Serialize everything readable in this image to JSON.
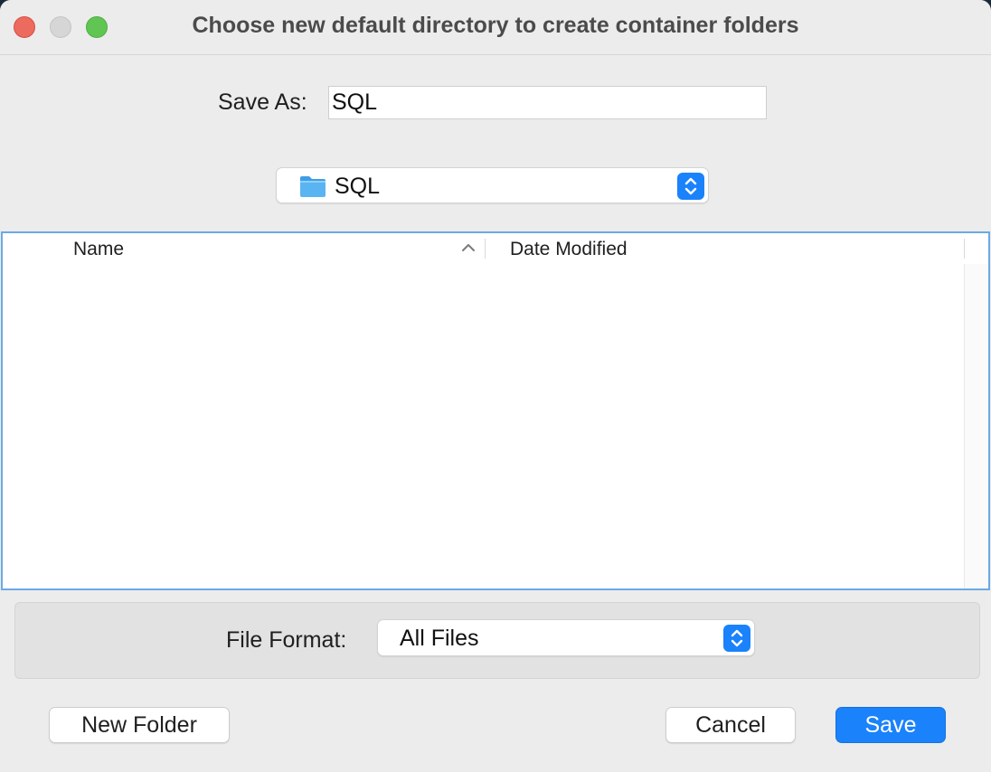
{
  "window": {
    "title": "Choose new default directory to create container folders"
  },
  "save_as": {
    "label": "Save As:",
    "value": "SQL"
  },
  "location": {
    "selected": "SQL",
    "icon": "folder-icon"
  },
  "file_list": {
    "columns": [
      "Name",
      "Date Modified"
    ],
    "sort_column": "Name",
    "sort_direction": "ascending",
    "rows": []
  },
  "file_format": {
    "label": "File Format:",
    "selected": "All Files"
  },
  "buttons": {
    "new_folder": "New Folder",
    "cancel": "Cancel",
    "save": "Save"
  },
  "colors": {
    "accent": "#1a82fb",
    "close": "#ed6a5e",
    "minimize": "#d6d6d6",
    "maximize": "#61c554",
    "list_focus_border": "#6ca9e6"
  }
}
